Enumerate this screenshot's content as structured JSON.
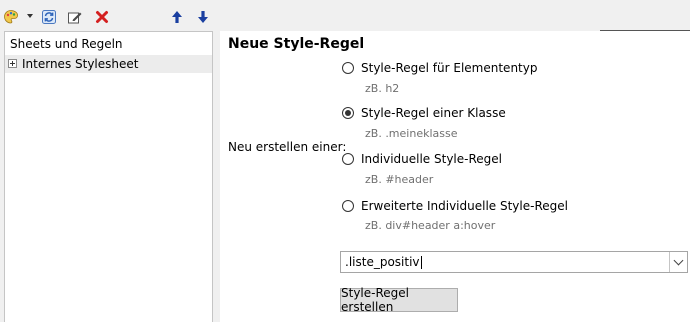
{
  "toolbar": {
    "icons": [
      "palette-icon",
      "refresh-icon",
      "edit-icon",
      "delete-icon",
      "arrow-up-icon",
      "arrow-down-icon"
    ]
  },
  "tree": {
    "header": "Sheets und Regeln",
    "items": [
      {
        "label": "Internes Stylesheet",
        "expanded": false
      }
    ]
  },
  "form": {
    "title": "Neue Style-Regel",
    "side_label": "Neu erstellen einer:",
    "options": [
      {
        "label": "Style-Regel für Elemententyp",
        "hint": "zB. h2",
        "checked": false
      },
      {
        "label": "Style-Regel einer Klasse",
        "hint": "zB. .meineklasse",
        "checked": true
      },
      {
        "label": "Individuelle Style-Regel",
        "hint": "zB. #header",
        "checked": false
      },
      {
        "label": "Erweiterte Individuelle Style-Regel",
        "hint": "zB. div#header a:hover",
        "checked": false
      }
    ],
    "input_value": ".liste_positiv",
    "submit_label": "Style-Regel erstellen"
  },
  "colors": {
    "arrow_blue": "#1a3fa0",
    "delete_red": "#d42020",
    "selection_gray": "#ececec"
  }
}
